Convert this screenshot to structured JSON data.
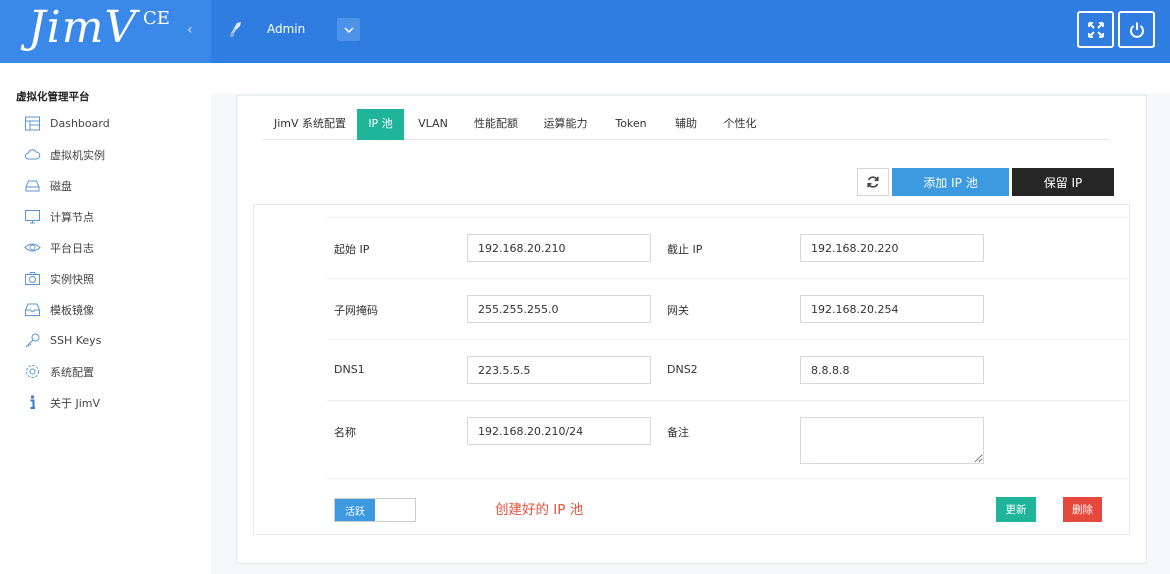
{
  "header": {
    "logo": "JimV",
    "logo_suffix": "CE",
    "collapse_icon": "chevron-left-icon",
    "user_name": "Admin",
    "fullscreen_icon": "expand-icon",
    "power_icon": "power-icon",
    "color": "#2f7de1"
  },
  "sidebar": {
    "title": "虚拟化管理平台",
    "items": [
      {
        "label": "Dashboard",
        "icon": "dashboard-icon"
      },
      {
        "label": "虚拟机实例",
        "icon": "cloud-icon"
      },
      {
        "label": "磁盘",
        "icon": "disk-icon"
      },
      {
        "label": "计算节点",
        "icon": "monitor-icon"
      },
      {
        "label": "平台日志",
        "icon": "eye-icon"
      },
      {
        "label": "实例快照",
        "icon": "camera-icon"
      },
      {
        "label": "模板镜像",
        "icon": "inbox-icon"
      },
      {
        "label": "SSH Keys",
        "icon": "key-icon"
      },
      {
        "label": "系统配置",
        "icon": "gear-icon"
      },
      {
        "label": "关于 JimV",
        "icon": "info-icon"
      }
    ]
  },
  "tabs": [
    {
      "label": "JimV 系统配置",
      "active": false
    },
    {
      "label": "IP 池",
      "active": true
    },
    {
      "label": "VLAN",
      "active": false
    },
    {
      "label": "性能配额",
      "active": false
    },
    {
      "label": "运算能力",
      "active": false
    },
    {
      "label": "Token",
      "active": false
    },
    {
      "label": "辅助",
      "active": false
    },
    {
      "label": "个性化",
      "active": false
    }
  ],
  "toolbar": {
    "refresh_icon": "refresh-icon",
    "add_label": "添加 IP 池",
    "reserve_label": "保留 IP"
  },
  "form": {
    "start_ip_label": "起始 IP",
    "start_ip": "192.168.20.210",
    "end_ip_label": "截止 IP",
    "end_ip": "192.168.20.220",
    "netmask_label": "子网掩码",
    "netmask": "255.255.255.0",
    "gateway_label": "网关",
    "gateway": "192.168.20.254",
    "dns1_label": "DNS1",
    "dns1": "223.5.5.5",
    "dns2_label": "DNS2",
    "dns2": "8.8.8.8",
    "name_label": "名称",
    "name": "192.168.20.210/24",
    "remark_label": "备注",
    "remark": ""
  },
  "footer": {
    "active_label": "活跃",
    "note": "创建好的 IP 池",
    "update_label": "更新",
    "delete_label": "删除"
  },
  "colors": {
    "accent_green": "#1fb59b",
    "accent_blue": "#3d9ae0",
    "danger_red": "#e5483c",
    "note_red": "#e8513a"
  }
}
